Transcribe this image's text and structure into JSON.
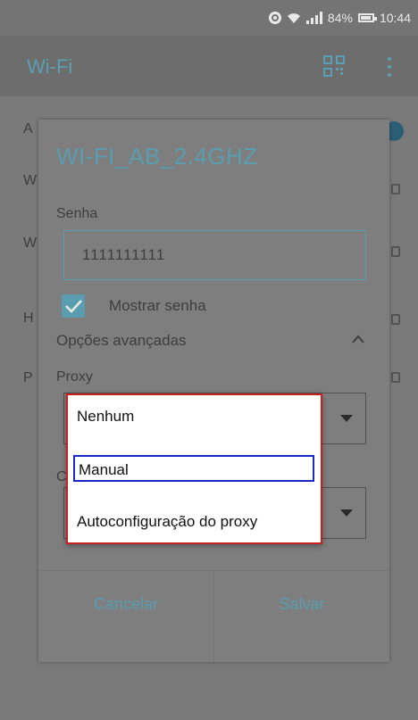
{
  "status_bar": {
    "battery": "84%",
    "time": "10:44"
  },
  "app_bar": {
    "title": "Wi-Fi"
  },
  "background_rows": [
    "A",
    "W",
    "W",
    "H",
    "P"
  ],
  "dialog": {
    "title": "WI-FI_AB_2.4GHZ",
    "password_label": "Senha",
    "password_value": "1111111111",
    "show_password_label": "Mostrar senha",
    "show_password_checked": true,
    "advanced_label": "Opções avançadas",
    "proxy_label": "Proxy",
    "ip_label_initial": "C",
    "cancel_label": "Cancelar",
    "save_label": "Salvar"
  },
  "proxy_dropdown": {
    "options": [
      "Nenhum",
      "Manual",
      "Autoconfiguração do proxy"
    ],
    "highlighted": "Manual"
  },
  "colors": {
    "accent": "#5a9db0",
    "popup_border": "#c81e1e",
    "highlight_border": "#1828c8"
  }
}
